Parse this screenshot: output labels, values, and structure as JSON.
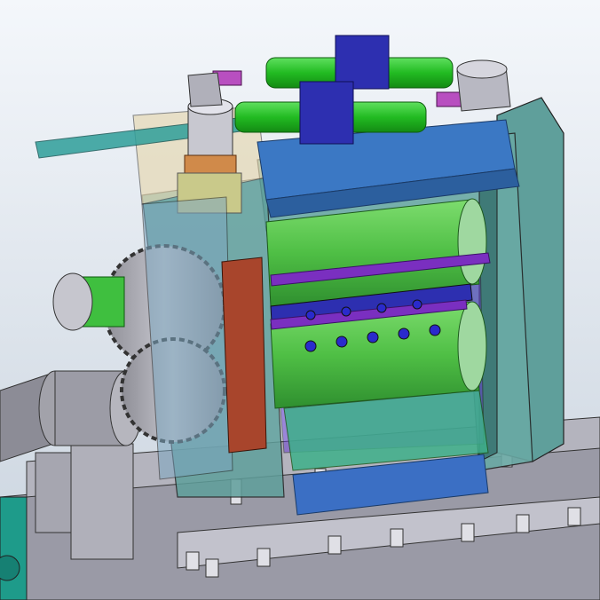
{
  "scene": {
    "kind": "cad-assembly-render",
    "components": [
      {
        "id": "housing",
        "name": "mill-housing"
      },
      {
        "id": "rolls",
        "name": "work-rolls"
      },
      {
        "id": "gears",
        "name": "pinion-gears"
      },
      {
        "id": "cylinders",
        "name": "hydraulic-cylinders"
      },
      {
        "id": "base",
        "name": "base-frame"
      }
    ],
    "colors": {
      "background_top": "#f4f7fb",
      "background_bottom": "#c9d3de",
      "housing": "#5f9f9b",
      "housing_dark": "#3f7a77",
      "roll_green": "#4fbf45",
      "roll_dark": "#2f8f2f",
      "top_beam": "#3b78c4",
      "purple_bar": "#7a2fc0",
      "blue_block": "#2d2fb0",
      "cylinder_green": "#22bb22",
      "rust_plate": "#a8452c",
      "gear_grey": "#a8a8b0",
      "base_grey": "#9a9aa6",
      "teal_motor": "#1e9b8a"
    }
  }
}
